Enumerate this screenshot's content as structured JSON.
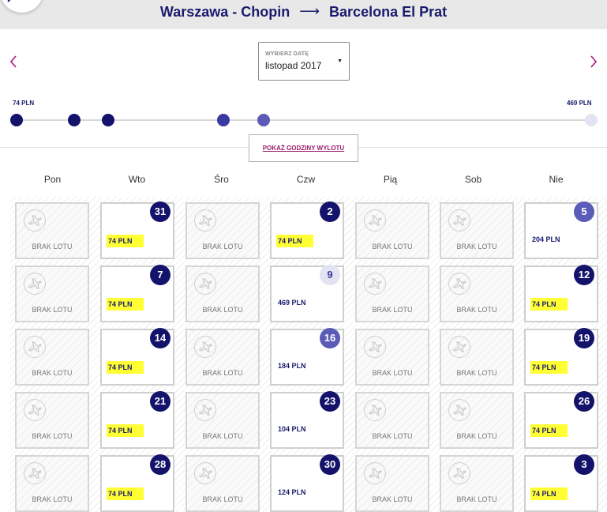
{
  "route": {
    "origin": "Warszawa - Chopin",
    "arrow": "⟶",
    "destination": "Barcelona El Prat"
  },
  "date_picker": {
    "label": "WYBIERZ DATĘ",
    "value": "listopad 2017"
  },
  "price_range": {
    "min": "74 PLN",
    "max": "469 PLN"
  },
  "show_hours_label": "POKAŻ GODZINY WYLOTU",
  "weekdays": [
    "Pon",
    "Wto",
    "Śro",
    "Czw",
    "Pią",
    "Sob",
    "Nie"
  ],
  "no_flight_label": "BRAK LOTU",
  "colors": {
    "navy": "#13136b",
    "mid": "#3a3aa0",
    "light": "#5b5bb8",
    "pale": "#e3e3f3",
    "highlight": "#ffff33"
  },
  "price_dots": [
    {
      "level": 0,
      "shade": "navy"
    },
    {
      "level": 0.1,
      "shade": "navy"
    },
    {
      "level": 0.16,
      "shade": "navy"
    },
    {
      "level": 0.36,
      "shade": "mid"
    },
    {
      "level": 0.43,
      "shade": "light"
    },
    {
      "level": 1,
      "shade": "pale"
    }
  ],
  "weeks": [
    [
      {
        "type": "empty"
      },
      {
        "day": "31",
        "price": "74 PLN",
        "shade": "navy",
        "highlight": true
      },
      {
        "type": "empty"
      },
      {
        "day": "2",
        "price": "74 PLN",
        "shade": "navy",
        "highlight": true
      },
      {
        "type": "empty"
      },
      {
        "type": "empty"
      },
      {
        "day": "5",
        "price": "204 PLN",
        "shade": "light",
        "highlight": false
      }
    ],
    [
      {
        "type": "empty"
      },
      {
        "day": "7",
        "price": "74 PLN",
        "shade": "navy",
        "highlight": true
      },
      {
        "type": "empty"
      },
      {
        "day": "9",
        "price": "469 PLN",
        "shade": "pale",
        "highlight": false
      },
      {
        "type": "empty"
      },
      {
        "type": "empty"
      },
      {
        "day": "12",
        "price": "74 PLN",
        "shade": "navy",
        "highlight": true
      }
    ],
    [
      {
        "type": "empty"
      },
      {
        "day": "14",
        "price": "74 PLN",
        "shade": "navy",
        "highlight": true
      },
      {
        "type": "empty"
      },
      {
        "day": "16",
        "price": "184 PLN",
        "shade": "light",
        "highlight": false
      },
      {
        "type": "empty"
      },
      {
        "type": "empty"
      },
      {
        "day": "19",
        "price": "74 PLN",
        "shade": "navy",
        "highlight": true
      }
    ],
    [
      {
        "type": "empty"
      },
      {
        "day": "21",
        "price": "74 PLN",
        "shade": "navy",
        "highlight": true
      },
      {
        "type": "empty"
      },
      {
        "day": "23",
        "price": "104 PLN",
        "shade": "navy",
        "highlight": false
      },
      {
        "type": "empty"
      },
      {
        "type": "empty"
      },
      {
        "day": "26",
        "price": "74 PLN",
        "shade": "navy",
        "highlight": true
      }
    ],
    [
      {
        "type": "empty"
      },
      {
        "day": "28",
        "price": "74 PLN",
        "shade": "navy",
        "highlight": true
      },
      {
        "type": "empty"
      },
      {
        "day": "30",
        "price": "124 PLN",
        "shade": "navy",
        "highlight": false
      },
      {
        "type": "empty"
      },
      {
        "type": "empty"
      },
      {
        "day": "3",
        "price": "74 PLN",
        "shade": "navy",
        "highlight": true
      }
    ]
  ]
}
